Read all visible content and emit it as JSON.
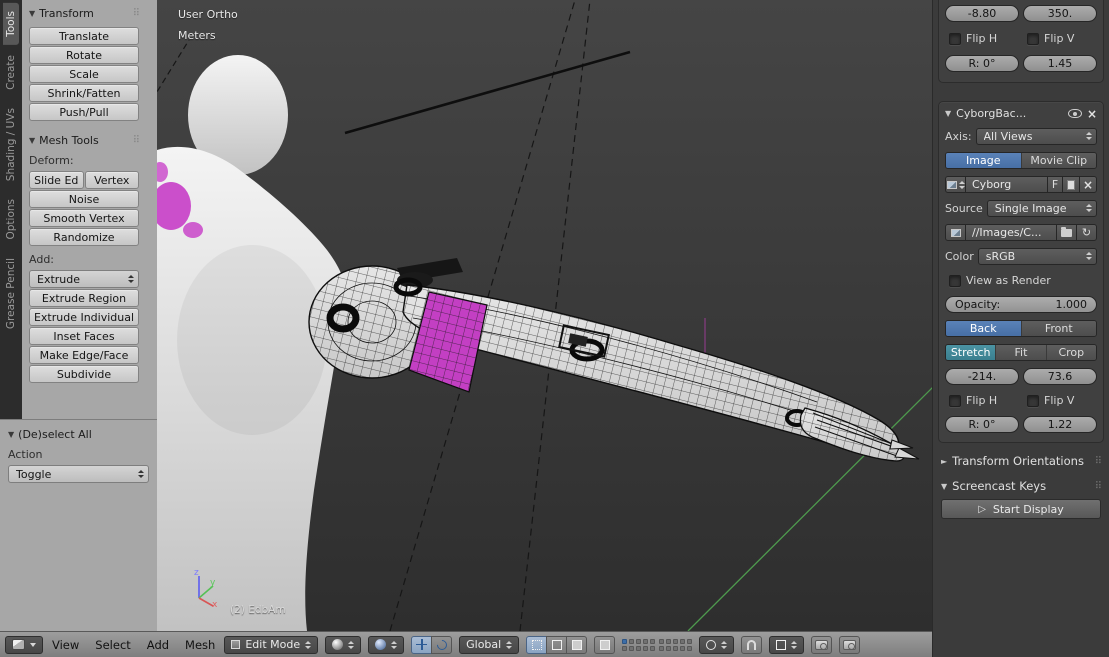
{
  "icons": {
    "grip": "⠿",
    "close": "×",
    "collapse": "▼",
    "collapsed": "►",
    "play": "▷",
    "refresh": "↻",
    "fake_user": "F"
  },
  "left_tabs": {
    "items": [
      {
        "label": "Tools"
      },
      {
        "label": "Create"
      },
      {
        "label": "Shading / UVs"
      },
      {
        "label": "Options"
      },
      {
        "label": "Grease Pencil"
      }
    ]
  },
  "tool_shelf": {
    "transform": {
      "title": "Transform",
      "b0": "Translate",
      "b1": "Rotate",
      "b2": "Scale",
      "b3": "Shrink/Fatten",
      "b4": "Push/Pull"
    },
    "mesh_tools": {
      "title": "Mesh Tools",
      "deform_label": "Deform:",
      "slide_edge": "Slide Ed",
      "slide_vertex": "Vertex",
      "noise": "Noise",
      "smooth_vertex": "Smooth Vertex",
      "randomize": "Randomize",
      "add_label": "Add:",
      "extrude": "Extrude",
      "extrude_region": "Extrude Region",
      "extrude_individual": "Extrude Individual",
      "inset_faces": "Inset Faces",
      "make_edge_face": "Make Edge/Face",
      "subdivide": "Subdivide"
    },
    "redo": {
      "title": "(De)select All",
      "action_label": "Action",
      "action_value": "Toggle"
    }
  },
  "viewport": {
    "view_name": "User Ortho",
    "units": "Meters",
    "object_info": "(2) EdbAm",
    "axis_x": "x",
    "axis_y": "y",
    "axis_z": "z"
  },
  "bg_settings": {
    "img1": {
      "x": "-8.80",
      "y": "350.",
      "flip_h": "Flip H",
      "flip_v": "Flip V",
      "rot": "R: 0°",
      "scale": "1.45"
    },
    "img2": {
      "name": "CyborgBac...",
      "axis_label": "Axis:",
      "axis_value": "All Views",
      "src_image": "Image",
      "src_movie": "Movie Clip",
      "datablock_name": "Cyborg",
      "source_label": "Source",
      "source_value": "Single Image",
      "filepath": "//Images/C...",
      "color_label": "Color",
      "color_value": "sRGB",
      "view_as_render": "View as Render",
      "opacity_label": "Opacity:",
      "opacity_value": "1.000",
      "depth_back": "Back",
      "depth_front": "Front",
      "frame_stretch": "Stretch",
      "frame_fit": "Fit",
      "frame_crop": "Crop",
      "x": "-214.",
      "y": "73.6",
      "flip_h": "Flip H",
      "flip_v": "Flip V",
      "rot": "R: 0°",
      "scale": "1.22"
    },
    "transform_orientations": "Transform Orientations",
    "screencast_keys": "Screencast Keys",
    "start_display": "Start Display"
  },
  "header": {
    "view": "View",
    "select": "Select",
    "add": "Add",
    "mesh": "Mesh",
    "mode": "Edit Mode",
    "orientation": "Global"
  }
}
